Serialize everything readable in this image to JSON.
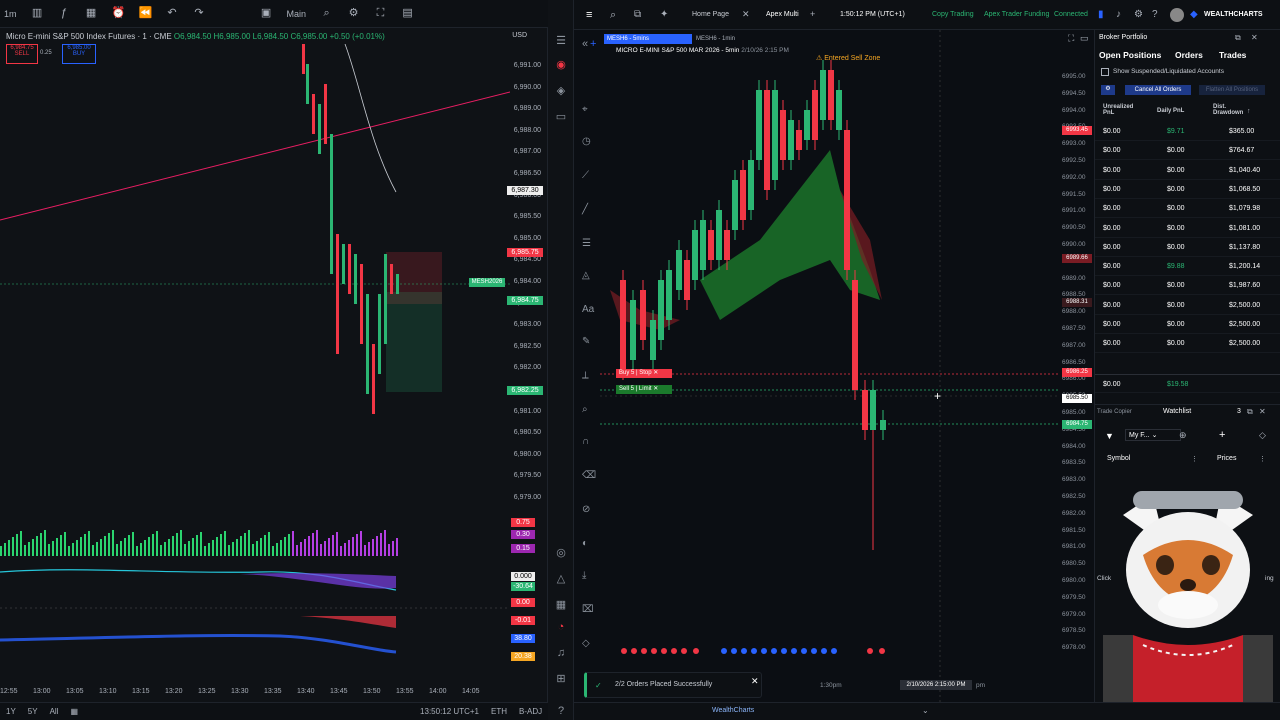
{
  "left_chart": {
    "timeframe": "1m",
    "title": "Micro E-mini S&P 500 Index Futures · 1 · CME",
    "ohlc": "O6,984.50 H6,985.00 L6,984.50 C6,985.00 +0.50 (+0.01%)",
    "sell_price": "6,984.75",
    "buy_price": "6,985.00",
    "sell_label": "SELL",
    "buy_label": "BUY",
    "spread": "0.25",
    "currency": "USD",
    "layout": "Main",
    "price_axis": [
      "6,991.00",
      "6,990.00",
      "6,989.00",
      "6,988.00",
      "6,987.00",
      "6,986.50",
      "6,986.00",
      "6,985.50",
      "6,985.00",
      "6,984.50",
      "6,984.00",
      "6,983.50",
      "6,983.00",
      "6,982.50",
      "6,982.00",
      "6,981.50",
      "6,981.00",
      "6,980.50",
      "6,980.00",
      "6,979.50",
      "6,979.00"
    ],
    "tag_6987": "6,987.30",
    "tag_red": "6,985.75",
    "tag_symbol": "MESH2026",
    "tag_green": "6,984.75",
    "tag_green2": "6,982.25",
    "time_axis": [
      "12:55",
      "13:00",
      "13:05",
      "13:10",
      "13:15",
      "13:20",
      "13:25",
      "13:30",
      "13:35",
      "13:40",
      "13:45",
      "13:50",
      "13:55",
      "14:00",
      "14:05"
    ],
    "osc_labels": [
      "0.75",
      "0.30",
      "0.15",
      "0.000",
      "-30.64",
      "0.00",
      "-0.01",
      "38.80",
      "20.38"
    ],
    "bottom_ranges": [
      "1Y",
      "5Y",
      "All"
    ],
    "clock": "13:50:12 UTC+1",
    "session": "ETH",
    "adj": "B-ADJ"
  },
  "browser": {
    "tab_home": "Home Page",
    "tab_apex": "Apex Multi",
    "time": "1:50:12 PM (UTC+1)",
    "status_copy": "Copy Trading",
    "status_funding": "Apex Trader Funding",
    "status_connected": "Connected",
    "brand": "WEALTHCHARTS",
    "footer_brand": "WealthCharts"
  },
  "center_chart": {
    "tab1": "MESH6 - 5mins",
    "tab2": "MESH6 - 1min",
    "title": "MICRO E-MINI S&P 500 MAR 2026 - 5min",
    "date": "2/10/26 2:15 PM",
    "alert": "Entered Sell Zone",
    "buy_stop": "Buy 5 | Stop",
    "sell_limit": "Sell 5 | Limit",
    "price_axis": [
      "6995.00",
      "6994.50",
      "6994.00",
      "6993.50",
      "6993.00",
      "6992.50",
      "6992.00",
      "6991.50",
      "6991.00",
      "6990.50",
      "6990.00",
      "6989.50",
      "6989.00",
      "6988.50",
      "6988.00",
      "6987.50",
      "6987.00",
      "6986.50",
      "6986.00",
      "6985.50",
      "6985.00",
      "6984.50",
      "6984.00",
      "6983.50",
      "6983.00",
      "6982.50",
      "6982.00",
      "6981.50",
      "6981.00",
      "6980.50",
      "6980.00",
      "6979.50",
      "6979.00",
      "6978.50",
      "6978.00"
    ],
    "tag1": "6993.45",
    "tag2": "6989.66",
    "tag3": "6988.31",
    "tag4": "6986.25",
    "tag5": "6985.50",
    "tag6": "6984.75",
    "time_label": "1:30pm",
    "crosshair_time": "2/10/2026 2:15:00 PM",
    "time_suffix": "pm"
  },
  "portfolio": {
    "title": "Broker Portfolio",
    "tab_positions": "Open Positions",
    "tab_orders": "Orders",
    "tab_trades": "Trades",
    "checkbox_label": "Show Suspended/Liquidated Accounts",
    "cancel_all": "Cancel All Orders",
    "flatten": "Flatten All Positions",
    "col_unrealized": "Unrealized PnL",
    "col_daily": "Daily PnL",
    "col_drawdown": "Dist. Drawdown",
    "rows": [
      [
        "$0.00",
        "$9.71",
        "$365.00"
      ],
      [
        "$0.00",
        "$0.00",
        "$764.67"
      ],
      [
        "$0.00",
        "$0.00",
        "$1,040.40"
      ],
      [
        "$0.00",
        "$0.00",
        "$1,068.50"
      ],
      [
        "$0.00",
        "$0.00",
        "$1,079.98"
      ],
      [
        "$0.00",
        "$0.00",
        "$1,081.00"
      ],
      [
        "$0.00",
        "$0.00",
        "$1,137.80"
      ],
      [
        "$0.00",
        "$9.88",
        "$1,200.14"
      ],
      [
        "$0.00",
        "$0.00",
        "$1,987.60"
      ],
      [
        "$0.00",
        "$0.00",
        "$2,500.00"
      ],
      [
        "$0.00",
        "$0.00",
        "$2,500.00"
      ],
      [
        "$0.00",
        "$0.00",
        "$2,500.00"
      ]
    ],
    "total_unrealized": "$0.00",
    "total_daily": "$19.58"
  },
  "watchlist": {
    "trade_copier": "Trade Copier",
    "title": "Watchlist",
    "count": "3",
    "list_name": "My F...",
    "col_symbol": "Symbol",
    "col_prices": "Prices",
    "side_text": "Click",
    "side_text2": "ing"
  },
  "toast": {
    "message": "2/2 Orders Placed Successfully"
  },
  "colors": {
    "up": "#2bb673",
    "down": "#f23645",
    "bg": "#0b0e13"
  }
}
